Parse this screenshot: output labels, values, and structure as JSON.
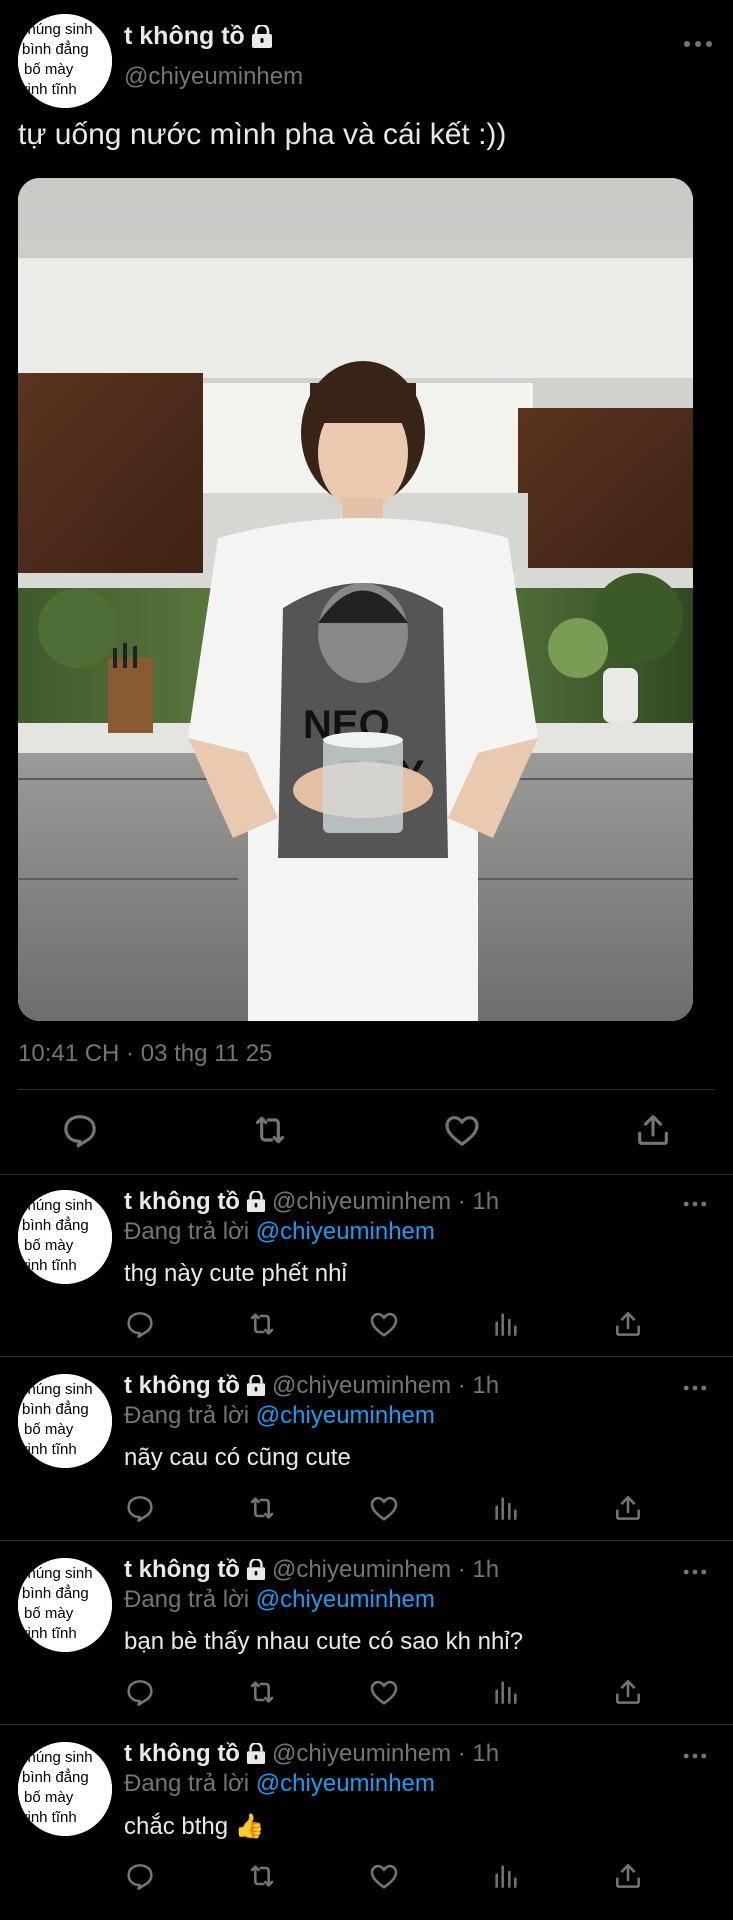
{
  "author": {
    "name": "t không tồ",
    "handle": "@chiyeuminhem",
    "avatar_text": [
      "chúng sinh",
      "bình đẳng",
      "bố     mày",
      "vinh   tĩnh"
    ]
  },
  "main_tweet": {
    "text": "tự uống nước mình pha và cái kết :))",
    "timestamp": "10:41 CH · 03 thg 11 25",
    "image_text": [
      "NEO",
      "BOY"
    ]
  },
  "replies": [
    {
      "name": "t không tồ",
      "handle_time": "@chiyeuminhem · 1h",
      "replying_prefix": "Đang trả lời",
      "replying_to": "@chiyeuminhem",
      "text": "thg này cute phết nhỉ"
    },
    {
      "name": "t không tồ",
      "handle_time": "@chiyeuminhem · 1h",
      "replying_prefix": "Đang trả lời",
      "replying_to": "@chiyeuminhem",
      "text": "nãy cau có cũng cute"
    },
    {
      "name": "t không tồ",
      "handle_time": "@chiyeuminhem · 1h",
      "replying_prefix": "Đang trả lời",
      "replying_to": "@chiyeuminhem",
      "text": "bạn bè thấy nhau cute có sao kh nhỉ?"
    },
    {
      "name": "t không tồ",
      "handle_time": "@chiyeuminhem · 1h",
      "replying_prefix": "Đang trả lời",
      "replying_to": "@chiyeuminhem",
      "text": "chắc bthg 👍"
    }
  ],
  "colors": {
    "background": "#000000",
    "text": "#e7e9ea",
    "secondary": "#71767b",
    "link": "#1d9bf0",
    "divider": "#2f3336"
  },
  "icons": [
    "more-icon",
    "lock-icon",
    "reply-icon",
    "retweet-icon",
    "like-icon",
    "share-icon",
    "views-icon"
  ]
}
